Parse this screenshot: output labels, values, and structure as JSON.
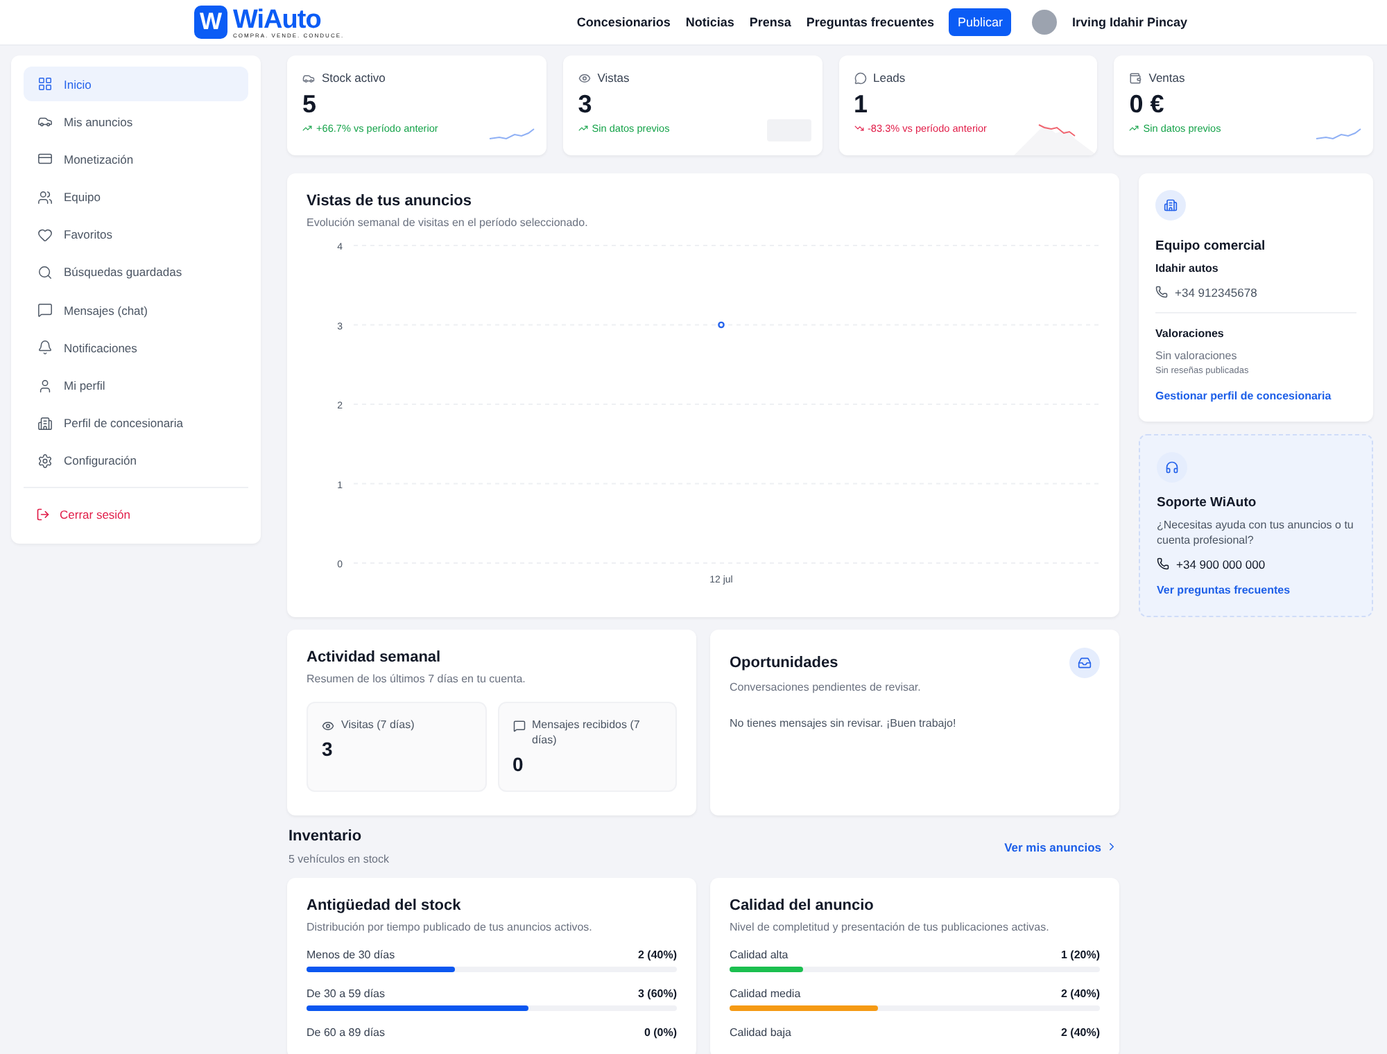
{
  "header": {
    "logo": {
      "mark": "W",
      "name": "WiAuto",
      "tagline": "COMPRA. VENDE. CONDUCE."
    },
    "nav": [
      "Concesionarios",
      "Noticias",
      "Prensa",
      "Preguntas frecuentes"
    ],
    "publish": "Publicar",
    "user": "Irving Idahir Pincay"
  },
  "sidebar": {
    "items": [
      {
        "label": "Inicio",
        "selected": true
      },
      {
        "label": "Mis anuncios",
        "selected": false
      },
      {
        "label": "Monetización",
        "selected": false
      },
      {
        "label": "Equipo",
        "selected": false
      },
      {
        "label": "Favoritos",
        "selected": false
      },
      {
        "label": "Búsquedas guardadas",
        "selected": false
      },
      {
        "label": "Mensajes (chat)",
        "selected": false
      },
      {
        "label": "Notificaciones",
        "selected": false
      },
      {
        "label": "Mi perfil",
        "selected": false
      },
      {
        "label": "Perfil de concesionaria",
        "selected": false
      },
      {
        "label": "Configuración",
        "selected": false
      }
    ],
    "logout": "Cerrar sesión"
  },
  "kpis": [
    {
      "label": "Stock activo",
      "value": "5",
      "change": "+66.7% vs período anterior",
      "negative": false,
      "kind": "line"
    },
    {
      "label": "Vistas",
      "value": "3",
      "change": "Sin datos previos",
      "negative": false,
      "kind": "empty"
    },
    {
      "label": "Leads",
      "value": "1",
      "change": "-83.3% vs período anterior",
      "negative": true,
      "kind": "area"
    },
    {
      "label": "Ventas",
      "value": "0 €",
      "change": "Sin datos previos",
      "negative": false,
      "kind": "line"
    }
  ],
  "views_chart": {
    "title": "Vistas de tus anuncios",
    "subtitle": "Evolución semanal de visitas en el período seleccionado.",
    "chart_data": {
      "type": "line",
      "categories": [
        "12 jul"
      ],
      "series": [
        {
          "color": "#2563eb",
          "values": [
            3
          ],
          "marker": true
        }
      ],
      "ylim": [
        0,
        4
      ],
      "yticks": [
        0,
        1,
        2,
        3,
        4
      ],
      "grid": true
    }
  },
  "weekly": {
    "title": "Actividad semanal",
    "subtitle": "Resumen de los últimos 7 días en tu cuenta.",
    "stats": [
      {
        "label": "Visitas (7 días)",
        "value": "3"
      },
      {
        "label": "Mensajes recibidos (7 días)",
        "value": "0"
      }
    ]
  },
  "opportunities": {
    "title": "Oportunidades",
    "subtitle": "Conversaciones pendientes de revisar.",
    "message": "No tienes mensajes sin revisar. ¡Buen trabajo!"
  },
  "inventory": {
    "title": "Inventario",
    "count": "5 vehículos en stock",
    "link": "Ver mis anuncios"
  },
  "stock_age": {
    "title": "Antigüedad del stock",
    "subtitle": "Distribución por tiempo publicado de tus anuncios activos.",
    "rows": [
      {
        "label": "Menos de 30 días",
        "value": "2 (40%)",
        "level": 0.4
      },
      {
        "label": "De 30 a 59 días",
        "value": "3 (60%)",
        "level": 0.6
      },
      {
        "label": "De 60 a 89 días",
        "value": "0 (0%)"
      }
    ]
  },
  "quality": {
    "title": "Calidad del anuncio",
    "subtitle": "Nivel de completitud y presentación de tus publicaciones activas.",
    "rows": [
      {
        "label": "Calidad alta",
        "value": "1 (20%)",
        "level": 0.2,
        "color": "#1bbf4f"
      },
      {
        "label": "Calidad media",
        "value": "2 (40%)",
        "level": 0.4,
        "color": "#f59a14"
      },
      {
        "label": "Calidad baja",
        "value": "2 (40%)"
      }
    ]
  },
  "team": {
    "title": "Equipo comercial",
    "dealer": "Idahir autos",
    "phone": "+34 912345678",
    "ratings_title": "Valoraciones",
    "ratings": "Sin valoraciones",
    "reviews": "Sin reseñas publicadas",
    "link": "Gestionar perfil de concesionaria"
  },
  "support": {
    "title": "Soporte WiAuto",
    "text": "¿Necesitas ayuda con tus anuncios o tu cuenta profesional?",
    "phone": "+34 900 000 000",
    "link": "Ver preguntas frecuentes"
  }
}
